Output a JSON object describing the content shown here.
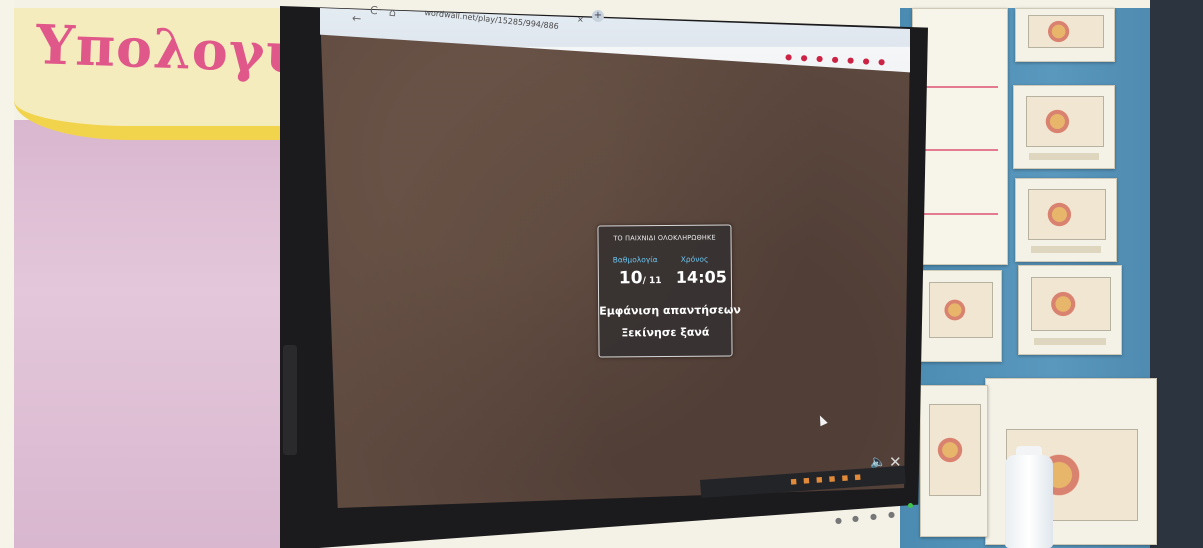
{
  "scene": {
    "banner_text": "Υπολογιστ"
  },
  "browser": {
    "url": "wordwall.net/play/15285/994/886",
    "tab_close": "×",
    "new_tab": "+",
    "back": "←",
    "forward": "→",
    "reload": "C",
    "home": "⌂"
  },
  "dialog": {
    "title": "ΤΟ ΠΑΙΧΝΙΔΙ ΟΛΟΚΛΗΡΩΘΗΚΕ",
    "score_label": "Βαθμολογία",
    "time_label": "Χρόνος",
    "score_value": "10",
    "score_total": "/ 11",
    "time_value": "14:05",
    "show_answers_button": "Εμφάνιση απαντήσεων",
    "restart_button": "Ξεκίνησε ξανά"
  },
  "controls": {
    "sound_icon": "🔈",
    "close_icon": "✕"
  },
  "colors": {
    "dialog_bg": "#373232",
    "label_blue": "#6cc4ee",
    "cork_brown": "#5f4a40",
    "banner_pink": "#e0578a"
  }
}
